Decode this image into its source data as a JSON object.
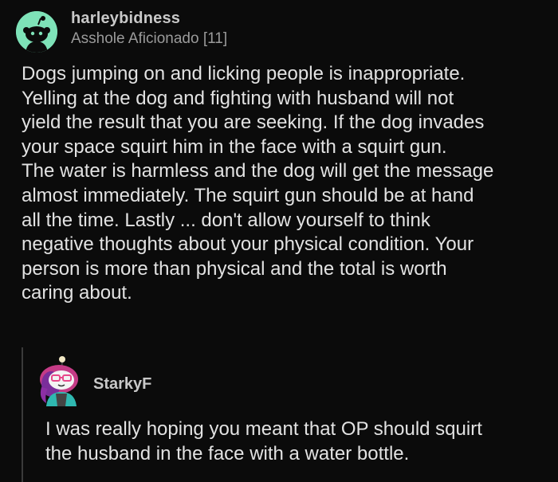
{
  "comment": {
    "username": "harleybidness",
    "flair": "Asshole Aficionado [11]",
    "body": "Dogs jumping on and licking people is inappropriate.\nYelling at the dog and fighting with husband will not\nyield the result that you are seeking.   If the dog invades\nyour space squirt him in the face with a squirt gun.\nThe water is harmless and the dog will get the message\nalmost immediately.   The squirt gun should be at hand\nall the time.   Lastly ... don't allow yourself to think\nnegative thoughts about your physical condition.   Your\nperson is more than physical and the total is worth\ncaring about.",
    "avatar_color": "#7ee2b8"
  },
  "reply": {
    "username": "StarkyF",
    "body": "I was really hoping you meant that OP should squirt\nthe husband in the face with a water bottle."
  }
}
